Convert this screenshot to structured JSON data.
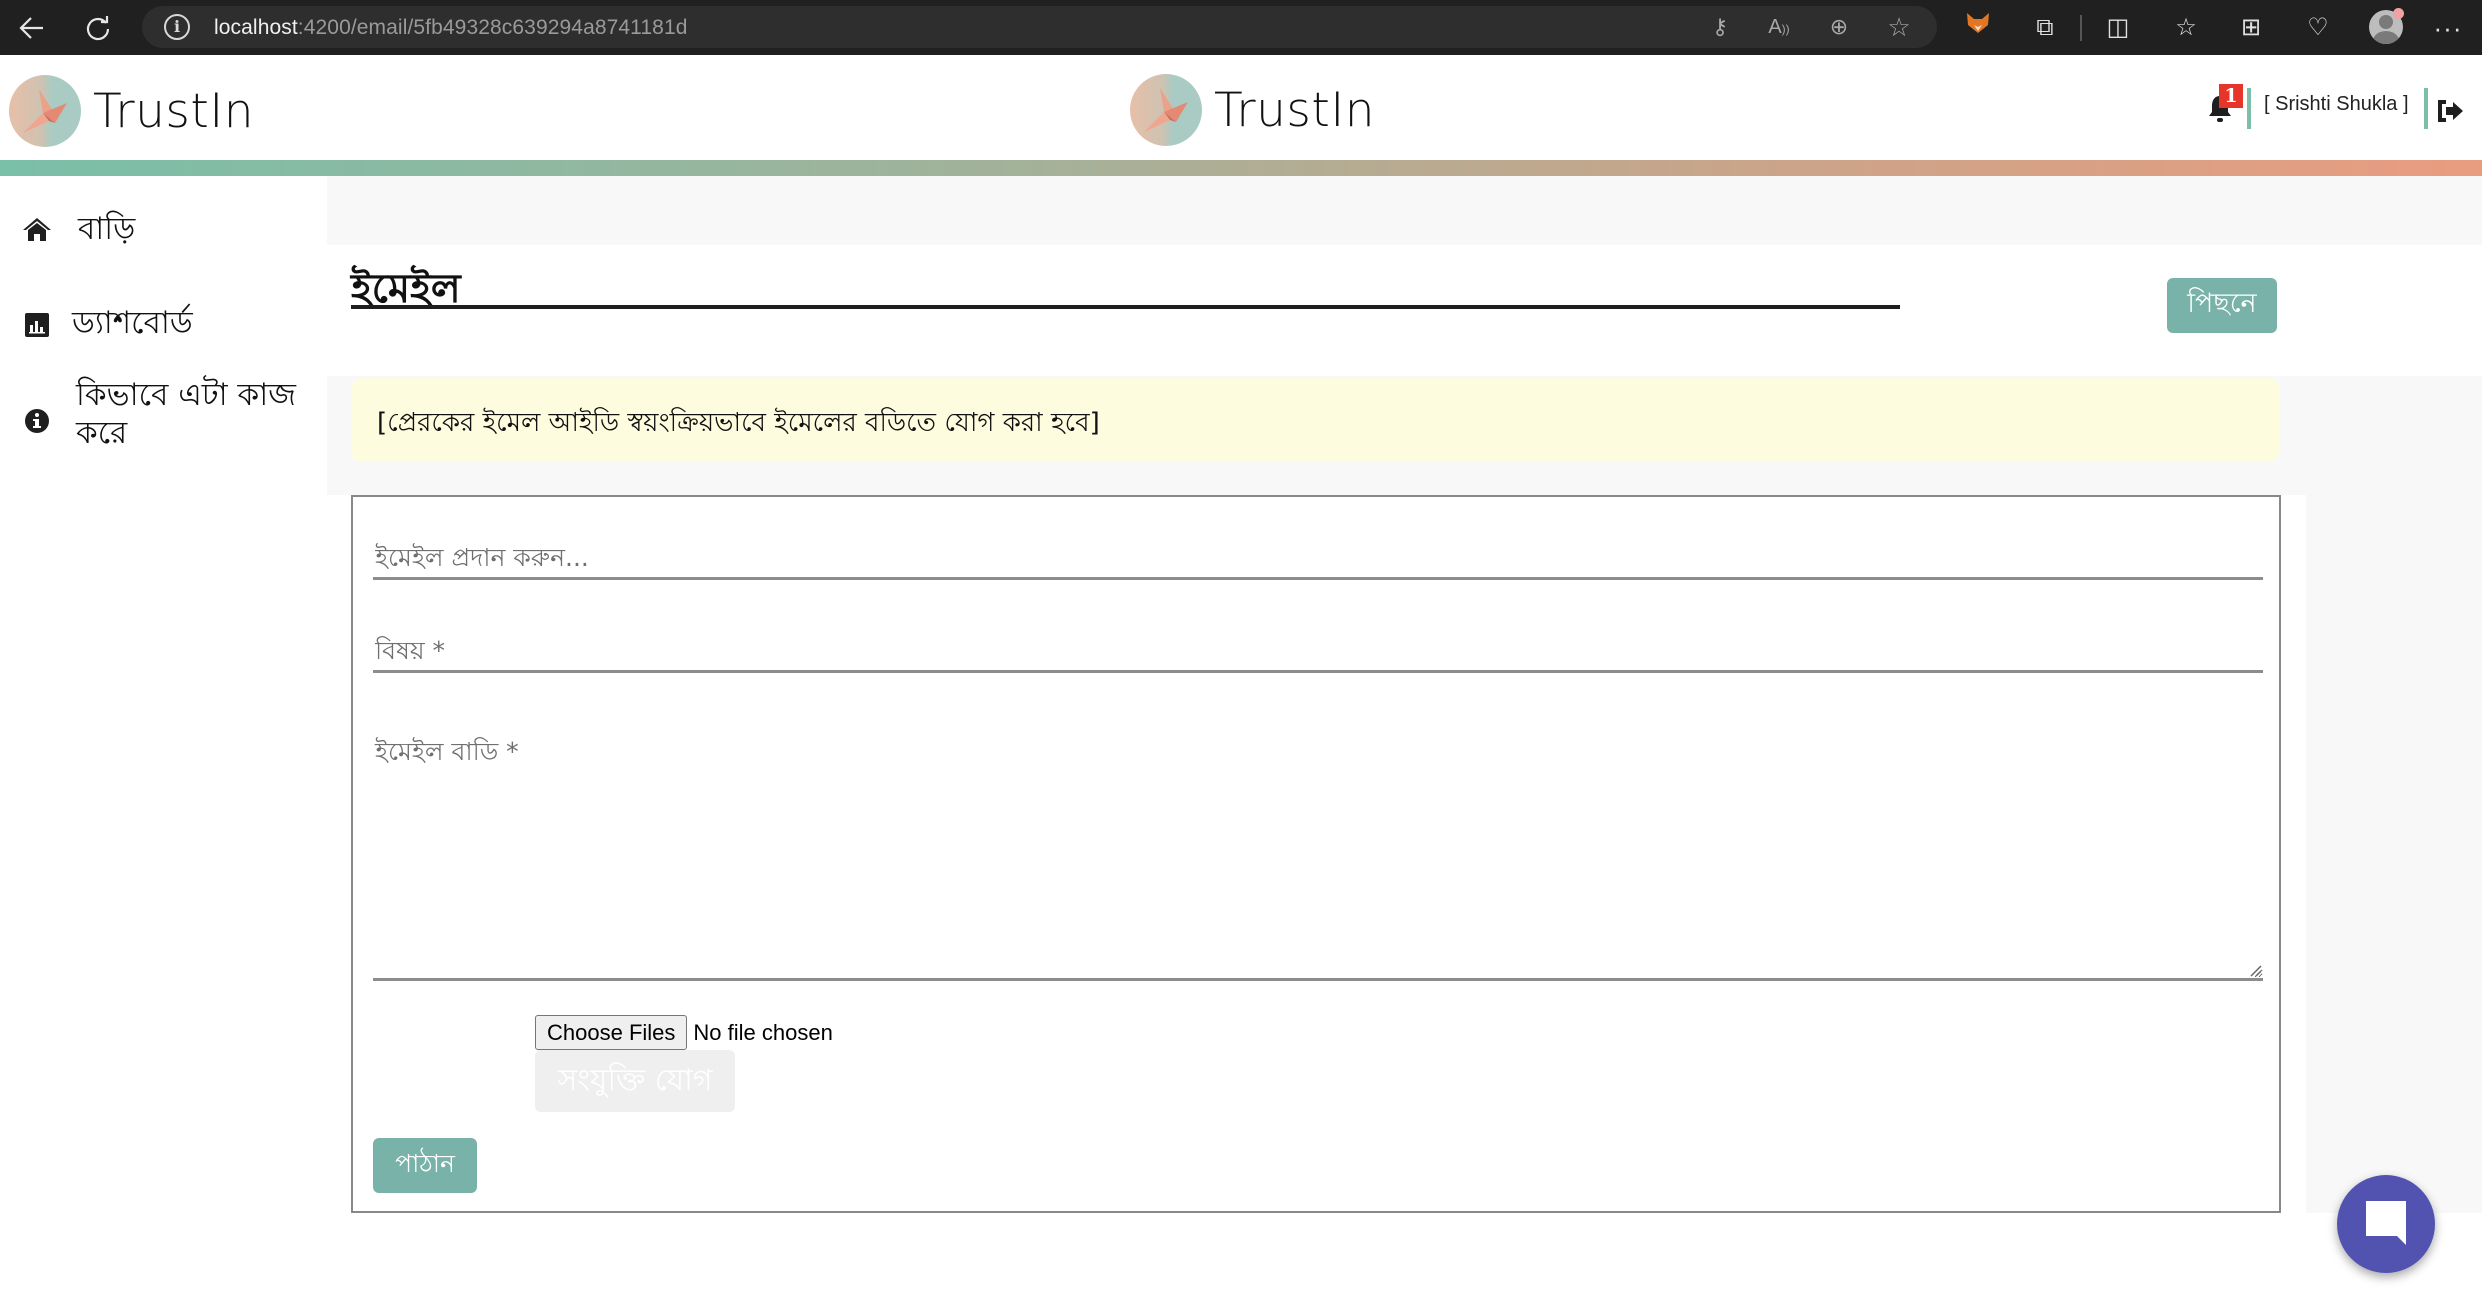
{
  "browser": {
    "url_host": "localhost",
    "url_rest": ":4200/email/5fb49328c639294a8741181d",
    "icons": {
      "back": "arrow-left-icon",
      "reload": "reload-icon",
      "site_info": "info-icon",
      "password": "key-icon",
      "read_aloud": "read-aloud-icon",
      "zoom": "zoom-in-icon",
      "favorite": "star-icon",
      "metamask": "fox-extension-icon",
      "extensions": "puzzle-icon",
      "split_screen": "split-screen-icon",
      "favorites": "favorites-list-icon",
      "collections": "collections-icon",
      "health": "browser-essentials-icon",
      "profile": "profile-avatar",
      "menu": "more-icon"
    }
  },
  "header": {
    "brand_left": "TrustIn",
    "brand_center": "TrustIn",
    "notification_count": "1",
    "username": "[ Srishti Shukla ]",
    "colors": {
      "accent": "#79b2a8",
      "gradient_start": "#7abfa8",
      "gradient_end": "#e99c80",
      "badge": "#e8352b"
    }
  },
  "sidebar": {
    "items": [
      {
        "label": "বাড়ি",
        "icon": "home-icon"
      },
      {
        "label": "ড্যাশবোর্ড",
        "icon": "bar-chart-icon"
      },
      {
        "label": "কিভাবে এটা কাজ করে",
        "icon": "info-circle-icon"
      }
    ]
  },
  "page": {
    "title": "ইমেইল",
    "back_label": "পিছনে",
    "notice": "[প্রেরকের ইমেল আইডি স্বয়ংক্রিয়ভাবে ইমেলের বডিতে যোগ করা হবে]"
  },
  "form": {
    "email_placeholder": "ইমেইল প্রদান করুন...",
    "email_value": "",
    "subject_placeholder": "বিষয় *",
    "subject_value": "",
    "body_placeholder": "ইমেইল বাডি *",
    "body_value": "",
    "choose_files_label": "Choose Files",
    "no_file_label": "No file chosen",
    "attach_label": "সংযুক্তি যোগ",
    "send_label": "পাঠান"
  },
  "chat": {
    "icon": "chat-bubble-icon",
    "color": "#5253b0"
  }
}
